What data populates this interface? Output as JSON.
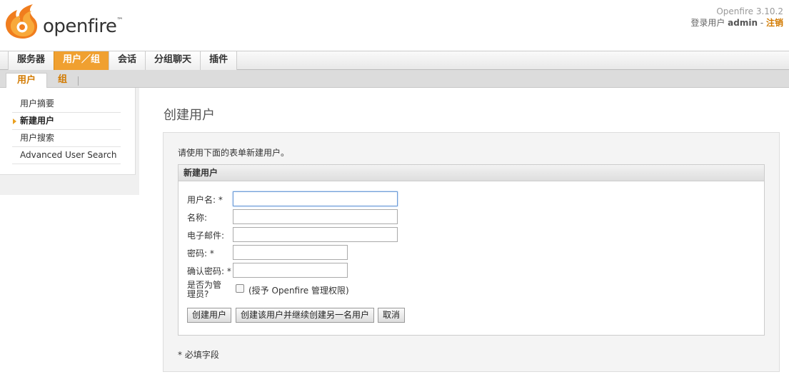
{
  "header": {
    "logo_text": "openfire",
    "trademark": "™",
    "version": "Openfire 3.10.2",
    "login_prefix": "登录用户",
    "username": "admin",
    "separator": " - ",
    "logout_label": "注销"
  },
  "main_nav": {
    "tabs": [
      {
        "label": "服务器"
      },
      {
        "label": "用户／组"
      },
      {
        "label": "会话"
      },
      {
        "label": "分组聊天"
      },
      {
        "label": "插件"
      }
    ],
    "active_index": 1
  },
  "sub_nav": {
    "tabs": [
      {
        "label": "用户"
      },
      {
        "label": "组"
      }
    ],
    "active_index": 0
  },
  "sidebar": {
    "items": [
      {
        "label": "用户摘要"
      },
      {
        "label": "新建用户"
      },
      {
        "label": "用户搜索"
      },
      {
        "label": "Advanced User Search"
      }
    ],
    "active_index": 1
  },
  "page": {
    "title": "创建用户",
    "intro": "请使用下面的表单新建用户。"
  },
  "form": {
    "panel_title": "新建用户",
    "fields": {
      "username": {
        "label": "用户名: *",
        "value": ""
      },
      "name": {
        "label": "名称:",
        "value": ""
      },
      "email": {
        "label": "电子邮件:",
        "value": ""
      },
      "password": {
        "label": "密码: *",
        "value": ""
      },
      "confirm_password": {
        "label": "确认密码: *",
        "value": ""
      }
    },
    "admin_label_line1": "是否为管",
    "admin_label_line2": "理员?",
    "admin_checkbox_label": "(授予 Openfire 管理权限)",
    "buttons": {
      "create": "创建用户",
      "create_another": "创建该用户并继续创建另一名用户",
      "cancel": "取消"
    },
    "required_note": "* 必填字段"
  },
  "colors": {
    "accent": "#f0a030",
    "link": "#d27a00"
  }
}
